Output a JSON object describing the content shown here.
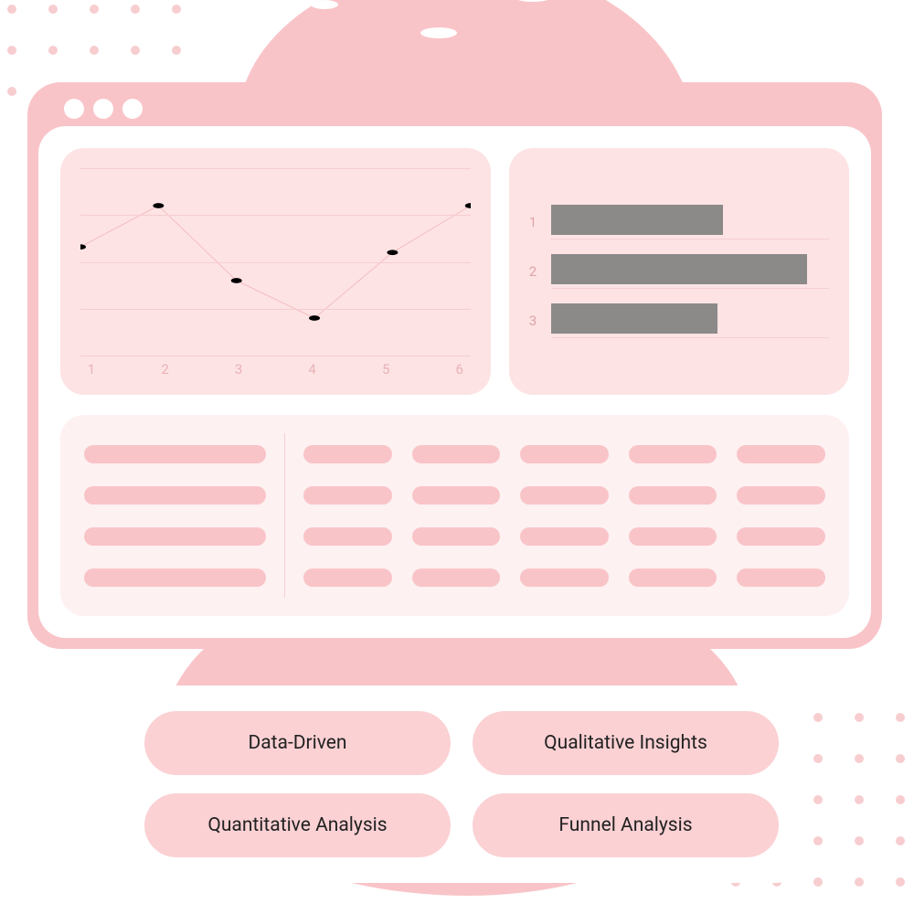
{
  "chart_data": [
    {
      "type": "line",
      "x": [
        1,
        2,
        3,
        4,
        5,
        6
      ],
      "values": [
        58,
        80,
        40,
        20,
        55,
        80
      ],
      "x_ticks": [
        "1",
        "2",
        "3",
        "4",
        "5",
        "6"
      ],
      "ylim": [
        0,
        100
      ],
      "grid": true
    },
    {
      "type": "bar",
      "orientation": "horizontal",
      "categories": [
        "1",
        "2",
        "3"
      ],
      "values": [
        62,
        92,
        60
      ],
      "xlim": [
        0,
        100
      ]
    }
  ],
  "table": {
    "rows": 4,
    "label_cols": 1,
    "data_cols": 5
  },
  "buttons": {
    "items": [
      {
        "label": "Data-Driven"
      },
      {
        "label": "Qualitative Insights"
      },
      {
        "label": "Quantitative Analysis"
      },
      {
        "label": "Funnel Analysis"
      }
    ]
  },
  "colors": {
    "accent_light": "#fde3e4",
    "accent_mid": "#f9c4c8",
    "bar_fill": "#8c8989"
  }
}
